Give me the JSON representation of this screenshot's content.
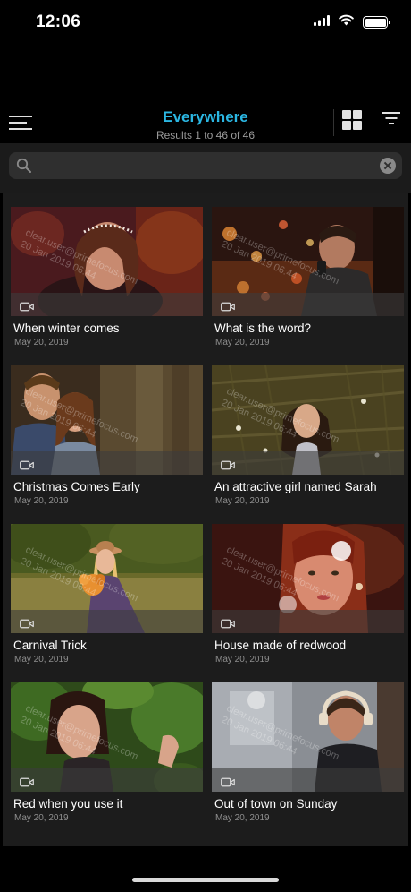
{
  "status_bar": {
    "time": "12:06"
  },
  "header": {
    "title": "Everywhere",
    "subtitle": "Results 1 to 46 of 46",
    "accent_color": "#2bb7e3"
  },
  "search": {
    "value": "",
    "placeholder": ""
  },
  "watermark": {
    "line1": "clear.user@primefocus.com",
    "line2": "20 Jan 2019 06:44"
  },
  "items": [
    {
      "title": "When winter comes",
      "date": "May 20, 2019"
    },
    {
      "title": "What is the word?",
      "date": "May 20, 2019"
    },
    {
      "title": "Christmas Comes Early",
      "date": "May 20, 2019"
    },
    {
      "title": "An attractive girl named Sarah",
      "date": "May 20, 2019"
    },
    {
      "title": "Carnival Trick",
      "date": "May 20, 2019"
    },
    {
      "title": "House made of redwood",
      "date": "May 20, 2019"
    },
    {
      "title": "Red when you use it",
      "date": "May 20, 2019"
    },
    {
      "title": "Out of town on Sunday",
      "date": "May 20, 2019"
    }
  ],
  "icons": {
    "menu": "hamburger-menu-icon",
    "grid": "grid-view-icon",
    "filter": "filter-icon",
    "search": "search-icon",
    "clear": "clear-icon",
    "video": "video-camera-icon"
  }
}
